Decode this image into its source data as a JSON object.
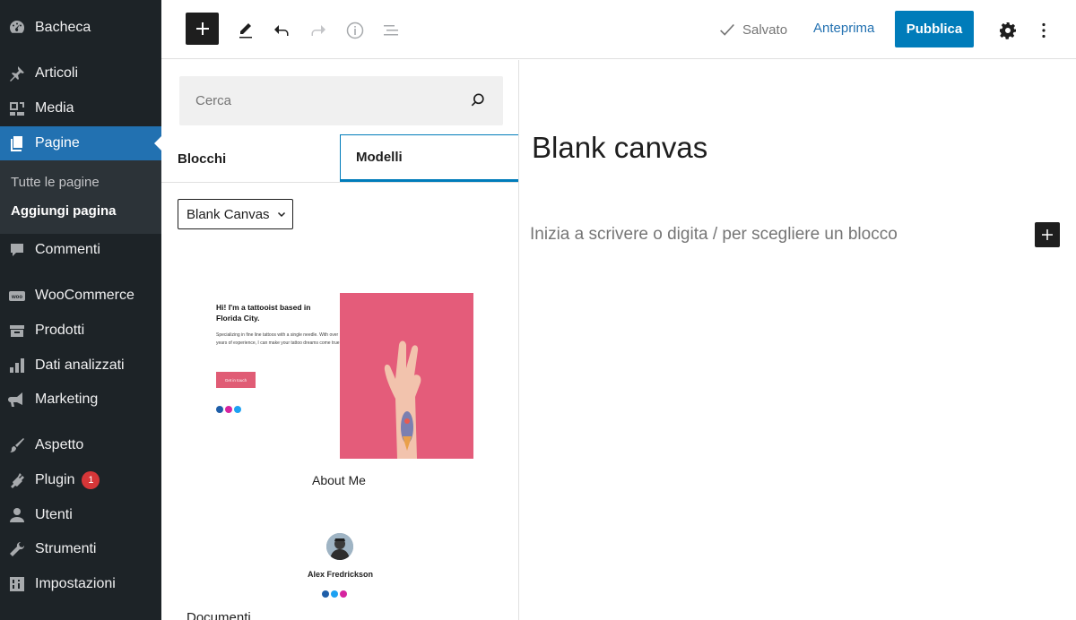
{
  "sidebar": {
    "items": [
      {
        "label": "Bacheca",
        "icon": "dashboard-icon"
      },
      {
        "label": "Articoli",
        "icon": "pin-icon"
      },
      {
        "label": "Media",
        "icon": "media-icon"
      },
      {
        "label": "Pagine",
        "icon": "pages-icon"
      },
      {
        "label": "Commenti",
        "icon": "comments-icon"
      },
      {
        "label": "WooCommerce",
        "icon": "woo-icon"
      },
      {
        "label": "Prodotti",
        "icon": "archive-icon"
      },
      {
        "label": "Dati analizzati",
        "icon": "chart-icon"
      },
      {
        "label": "Marketing",
        "icon": "megaphone-icon"
      },
      {
        "label": "Aspetto",
        "icon": "brush-icon"
      },
      {
        "label": "Plugin",
        "icon": "plugin-icon",
        "badge": "1"
      },
      {
        "label": "Utenti",
        "icon": "users-icon"
      },
      {
        "label": "Strumenti",
        "icon": "wrench-icon"
      },
      {
        "label": "Impostazioni",
        "icon": "settings-icon"
      }
    ],
    "submenu": [
      {
        "label": "Tutte le pagine"
      },
      {
        "label": "Aggiungi pagina"
      }
    ],
    "accent_color": "#2271b1"
  },
  "toolbar": {
    "saved_label": "Salvato",
    "preview_label": "Anteprima",
    "publish_label": "Pubblica",
    "publish_color": "#007cba"
  },
  "inserter": {
    "search_placeholder": "Cerca",
    "tabs": [
      "Blocchi",
      "Modelli"
    ],
    "active_tab": "Modelli",
    "category": "Blank Canvas",
    "patterns": [
      {
        "label": "About Me",
        "heading": "Hi! I'm a tattooist based in Florida City.",
        "body": "Specializing in fine line tattoos with a single needle. With over 10 years of experience, I can make your tattoo dreams come true.",
        "button": "Get in touch"
      },
      {
        "author": "Alex Fredrickson"
      }
    ],
    "footer_text": "Documenti"
  },
  "editor": {
    "title": "Blank canvas",
    "placeholder": "Inizia a scrivere o digita / per scegliere un blocco"
  }
}
